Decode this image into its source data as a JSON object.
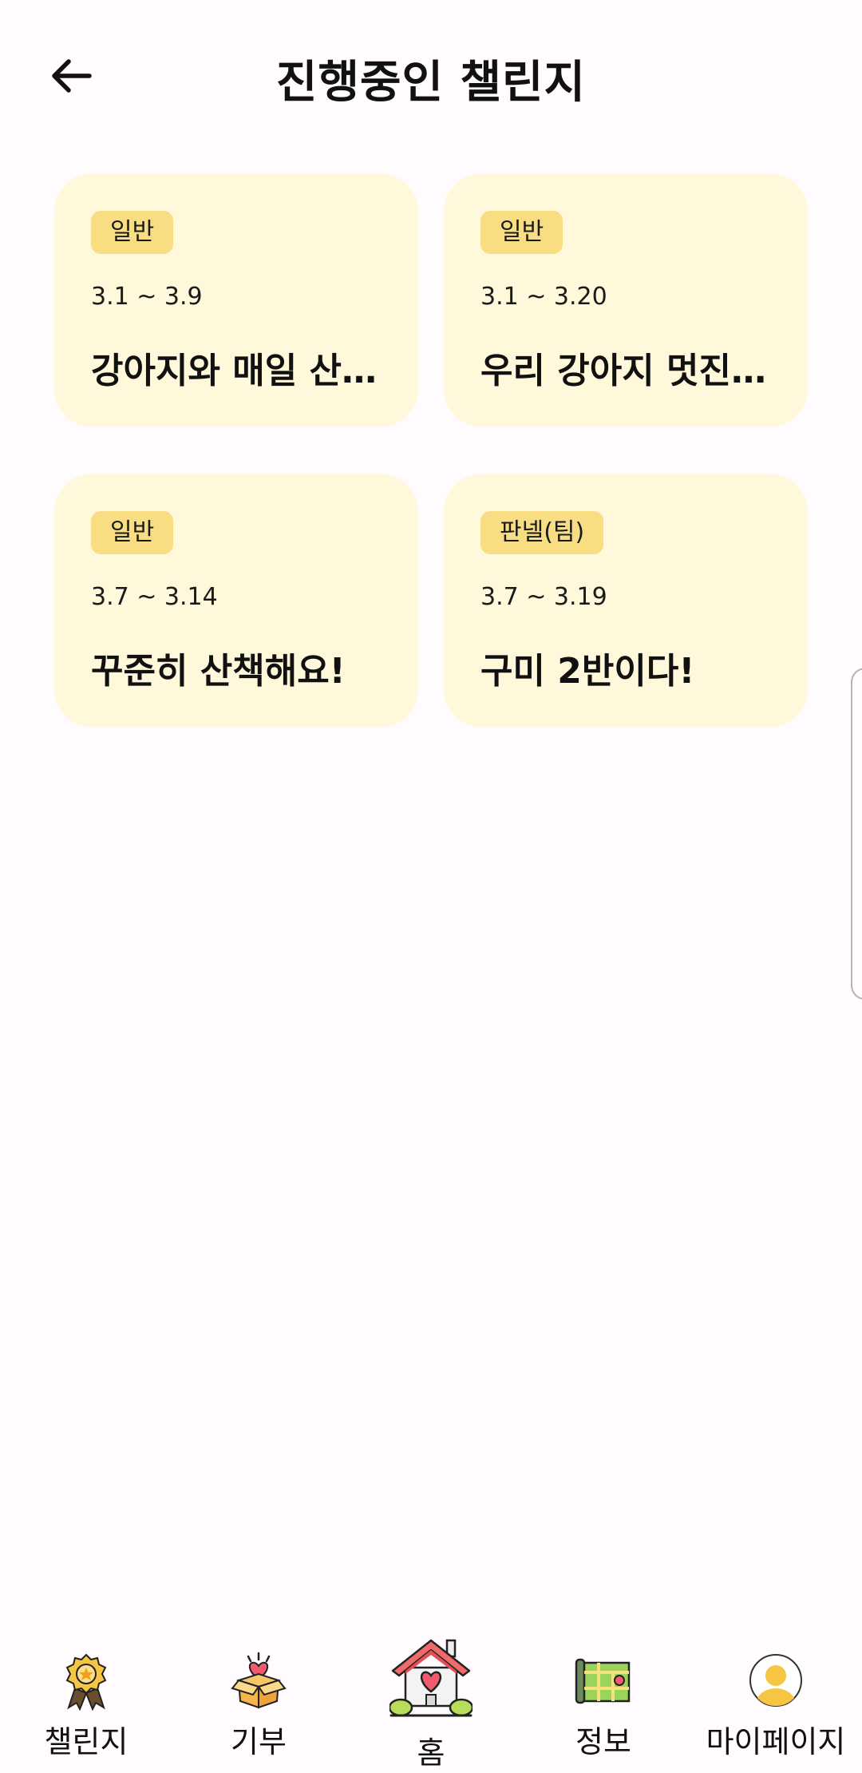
{
  "header": {
    "title": "진행중인 챌린지"
  },
  "challenges": [
    {
      "badge": "일반",
      "dates": "3.1 ~ 3.9",
      "title": "강아지와 매일 산책해요"
    },
    {
      "badge": "일반",
      "dates": "3.1 ~ 3.20",
      "title": "우리 강아지 멋진 산책"
    },
    {
      "badge": "일반",
      "dates": "3.7 ~ 3.14",
      "title": "꾸준히 산책해요!"
    },
    {
      "badge": "판넬(팀)",
      "dates": "3.7 ~ 3.19",
      "title": "구미 2반이다!"
    }
  ],
  "nav": [
    {
      "label": "챌린지",
      "icon": "medal-icon"
    },
    {
      "label": "기부",
      "icon": "donation-box-icon"
    },
    {
      "label": "홈",
      "icon": "home-heart-icon"
    },
    {
      "label": "정보",
      "icon": "map-icon"
    },
    {
      "label": "마이페이지",
      "icon": "profile-icon"
    }
  ],
  "colors": {
    "background": "#FFFBFE",
    "card": "#FFF8DA",
    "badge": "#F8DD82",
    "accent_yellow": "#F6C643",
    "home_roof": "#F06A6A"
  }
}
